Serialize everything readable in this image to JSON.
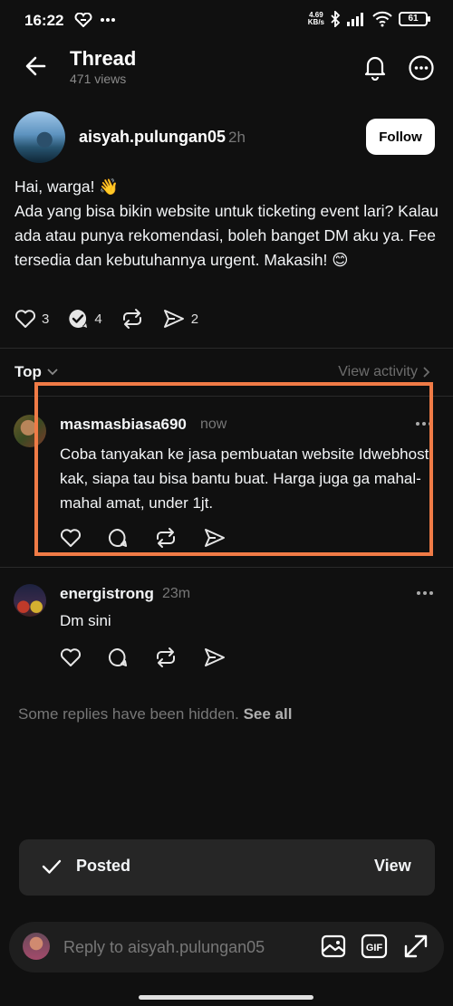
{
  "status_bar": {
    "time": "16:22",
    "net_speed_value": "4.69",
    "net_speed_unit": "KB/s",
    "battery": "61"
  },
  "header": {
    "title": "Thread",
    "views": "471 views"
  },
  "post": {
    "username": "aisyah.pulungan05",
    "time": "2h",
    "follow_label": "Follow",
    "text": "Hai, warga! 👋\nAda yang bisa bikin website untuk ticketing event lari? Kalau ada atau punya rekomendasi, boleh banget DM aku ya. Fee tersedia dan kebutuhannya urgent. Makasih! 😊",
    "likes": "3",
    "replies": "4",
    "shares": "2"
  },
  "sort": {
    "label": "Top",
    "view_activity": "View activity"
  },
  "replies": [
    {
      "username": "masmasbiasa690",
      "time": "now",
      "text": "Coba tanyakan ke jasa pembuatan website Idwebhost kak, siapa tau bisa bantu buat. Harga juga ga mahal-mahal amat, under 1jt."
    },
    {
      "username": "energistrong",
      "time": "23m",
      "text": "Dm sini"
    }
  ],
  "hidden_note": {
    "text": "Some replies have been hidden.",
    "link": "See all"
  },
  "toast": {
    "label": "Posted",
    "action": "View"
  },
  "reply_bar": {
    "placeholder": "Reply to aisyah.pulungan05",
    "gif_label": "GIF"
  },
  "colors": {
    "background": "#101010",
    "highlight": "#f07b46",
    "muted": "#777777"
  }
}
